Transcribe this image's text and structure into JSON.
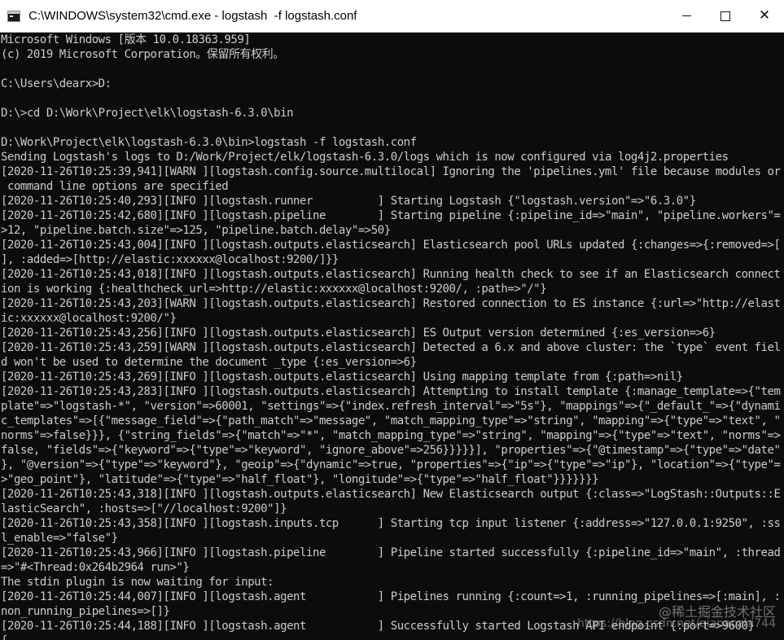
{
  "window": {
    "title": "C:\\WINDOWS\\system32\\cmd.exe - logstash  -f logstash.conf",
    "close_symbol": "✕"
  },
  "console": {
    "lines": [
      "Microsoft Windows [版本 10.0.18363.959]",
      "(c) 2019 Microsoft Corporation。保留所有权利。",
      "",
      "C:\\Users\\dearx>D:",
      "",
      "D:\\>cd D:\\Work\\Project\\elk\\logstash-6.3.0\\bin",
      "",
      "D:\\Work\\Project\\elk\\logstash-6.3.0\\bin>logstash -f logstash.conf",
      "Sending Logstash's logs to D:/Work/Project/elk/logstash-6.3.0/logs which is now configured via log4j2.properties",
      "[2020-11-26T10:25:39,941][WARN ][logstash.config.source.multilocal] Ignoring the 'pipelines.yml' file because modules or",
      " command line options are specified",
      "[2020-11-26T10:25:40,293][INFO ][logstash.runner          ] Starting Logstash {\"logstash.version\"=>\"6.3.0\"}",
      "[2020-11-26T10:25:42,680][INFO ][logstash.pipeline        ] Starting pipeline {:pipeline_id=>\"main\", \"pipeline.workers\"=",
      ">12, \"pipeline.batch.size\"=>125, \"pipeline.batch.delay\"=>50}",
      "[2020-11-26T10:25:43,004][INFO ][logstash.outputs.elasticsearch] Elasticsearch pool URLs updated {:changes=>{:removed=>[",
      "], :added=>[http://elastic:xxxxxx@localhost:9200/]}}",
      "[2020-11-26T10:25:43,018][INFO ][logstash.outputs.elasticsearch] Running health check to see if an Elasticsearch connect",
      "ion is working {:healthcheck_url=>http://elastic:xxxxxx@localhost:9200/, :path=>\"/\"}",
      "[2020-11-26T10:25:43,203][WARN ][logstash.outputs.elasticsearch] Restored connection to ES instance {:url=>\"http://elast",
      "ic:xxxxxx@localhost:9200/\"}",
      "[2020-11-26T10:25:43,256][INFO ][logstash.outputs.elasticsearch] ES Output version determined {:es_version=>6}",
      "[2020-11-26T10:25:43,259][WARN ][logstash.outputs.elasticsearch] Detected a 6.x and above cluster: the `type` event fiel",
      "d won't be used to determine the document _type {:es_version=>6}",
      "[2020-11-26T10:25:43,269][INFO ][logstash.outputs.elasticsearch] Using mapping template from {:path=>nil}",
      "[2020-11-26T10:25:43,283][INFO ][logstash.outputs.elasticsearch] Attempting to install template {:manage_template=>{\"tem",
      "plate\"=>\"logstash-*\", \"version\"=>60001, \"settings\"=>{\"index.refresh_interval\"=>\"5s\"}, \"mappings\"=>{\"_default_\"=>{\"dynami",
      "c_templates\"=>[{\"message_field\"=>{\"path_match\"=>\"message\", \"match_mapping_type\"=>\"string\", \"mapping\"=>{\"type\"=>\"text\", \"",
      "norms\"=>false}}}, {\"string_fields\"=>{\"match\"=>\"*\", \"match_mapping_type\"=>\"string\", \"mapping\"=>{\"type\"=>\"text\", \"norms\"=>",
      "false, \"fields\"=>{\"keyword\"=>{\"type\"=>\"keyword\", \"ignore_above\"=>256}}}}}], \"properties\"=>{\"@timestamp\"=>{\"type\"=>\"date\"",
      "}, \"@version\"=>{\"type\"=>\"keyword\"}, \"geoip\"=>{\"dynamic\"=>true, \"properties\"=>{\"ip\"=>{\"type\"=>\"ip\"}, \"location\"=>{\"type\"=",
      ">\"geo_point\"}, \"latitude\"=>{\"type\"=>\"half_float\"}, \"longitude\"=>{\"type\"=>\"half_float\"}}}}}}}",
      "[2020-11-26T10:25:43,318][INFO ][logstash.outputs.elasticsearch] New Elasticsearch output {:class=>\"LogStash::Outputs::E",
      "lasticSearch\", :hosts=>[\"//localhost:9200\"]}",
      "[2020-11-26T10:25:43,358][INFO ][logstash.inputs.tcp      ] Starting tcp input listener {:address=>\"127.0.0.1:9250\", :ss",
      "l_enable=>\"false\"}",
      "[2020-11-26T10:25:43,966][INFO ][logstash.pipeline        ] Pipeline started successfully {:pipeline_id=>\"main\", :thread",
      "=>\"#<Thread:0x264b2964 run>\"}",
      "The stdin plugin is now waiting for input:",
      "[2020-11-26T10:25:44,007][INFO ][logstash.agent           ] Pipelines running {:count=>1, :running_pipelines=>[:main], :",
      "non_running_pipelines=>[]}",
      "[2020-11-26T10:25:44,188][INFO ][logstash.agent           ] Successfully started Logstash API endpoint {:port=>9600}",
      "{"
    ]
  },
  "watermark": {
    "main": "@稀土掘金技术社区",
    "sub": "https://blog.csdn.net/qianaozhi744"
  }
}
